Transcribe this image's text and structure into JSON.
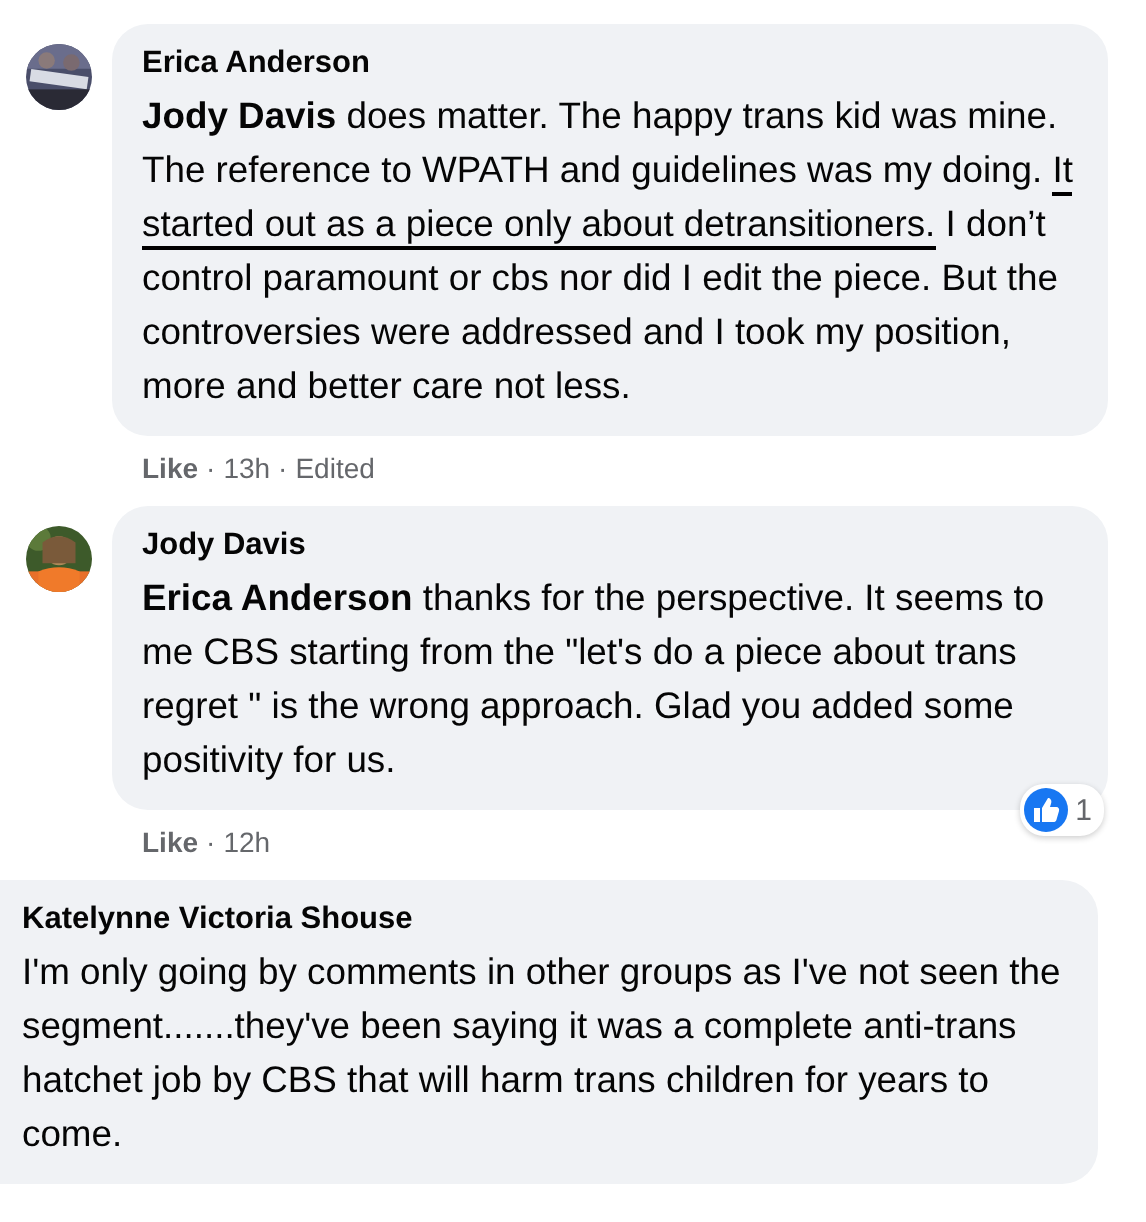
{
  "comments": [
    {
      "author": "Erica Anderson",
      "body": [
        {
          "text": "**Jody Davis** does matter. The happy trans kid was mine. The reference to WPATH and guidelines was my doing. ",
          "underlined": false
        },
        {
          "text": "It started out as a piece only about detransitioners.",
          "underlined": true
        },
        {
          "text": " I don’t control paramount or cbs nor did I edit the piece. But the controversies were addressed and I took my position, more and better care not less.",
          "underlined": false
        }
      ],
      "meta": [
        {
          "kind": "like",
          "text": "Like"
        },
        {
          "kind": "dot",
          "text": "·"
        },
        {
          "kind": "time",
          "text": "13h"
        },
        {
          "kind": "dot",
          "text": "·"
        },
        {
          "kind": "edited",
          "text": "Edited"
        }
      ]
    },
    {
      "author": "Jody Davis",
      "body": [
        {
          "text": "**Erica Anderson** thanks for the perspective. It seems to me CBS starting from the \"let's do a piece about trans regret \" is the wrong approach. Glad you added some positivity for us.",
          "underlined": false
        }
      ],
      "meta": [
        {
          "kind": "like",
          "text": "Like"
        },
        {
          "kind": "dot",
          "text": "·"
        },
        {
          "kind": "time",
          "text": "12h"
        }
      ],
      "reactions": {
        "count": "1"
      }
    },
    {
      "author": "Katelynne Victoria Shouse",
      "body": [
        {
          "text": "I'm only going by comments in other groups as I've not seen the segment.......they've been saying it was a complete anti-trans hatchet job by CBS that will harm trans children for years to come.",
          "underlined": false
        }
      ]
    }
  ]
}
